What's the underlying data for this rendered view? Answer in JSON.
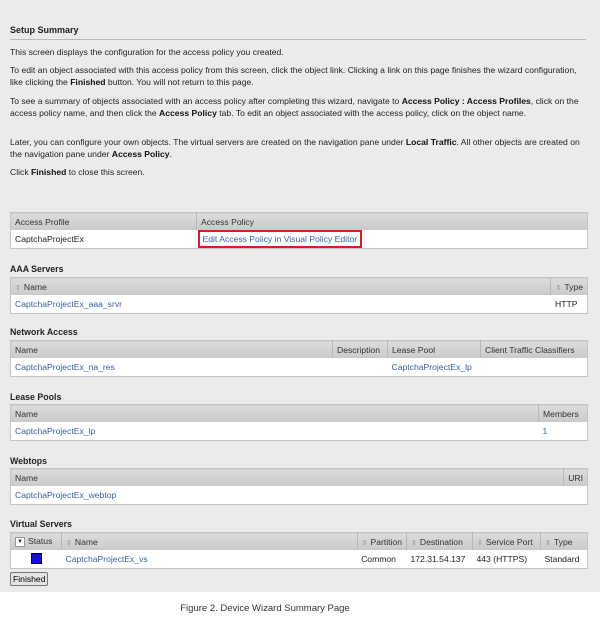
{
  "title": "Setup Summary",
  "paragraphs": {
    "p1": "This screen displays the configuration for the access policy you created.",
    "p2a": "To edit an object associated with this access policy from this screen, click the object link. Clicking a link on this page finishes the wizard configuration, like clicking the ",
    "p2b": "Finished",
    "p2c": " button. You will not return to this page.",
    "p3a": "To see a summary of objects associated with an access policy after completing this wizard, navigate to ",
    "p3b": "Access Policy : Access Profiles",
    "p3c": ", click on the access policy name, and then click the ",
    "p3d": "Access Policy",
    "p3e": " tab. To edit an object associated with the access policy, click on the object name.",
    "p4a": "Later, you can configure your own objects. The virtual servers are created on the navigation pane under ",
    "p4b": "Local Traffic",
    "p4c": ". All other objects are created on the navigation pane under ",
    "p4d": "Access Policy",
    "p4e": ".",
    "p5a": "Click ",
    "p5b": "Finished",
    "p5c": " to close this screen."
  },
  "access": {
    "headers": [
      "Access Profile",
      "Access Policy"
    ],
    "profile": "CaptchaProjectEx",
    "policy_link": "Edit Access Policy in Visual Policy Editor"
  },
  "aaa": {
    "title": "AAA Servers",
    "headers": [
      "Name",
      "Type"
    ],
    "name": "CaptchaProjectEx_aaa_srvr",
    "type": "HTTP"
  },
  "network": {
    "title": "Network Access",
    "headers": [
      "Name",
      "Description",
      "Lease Pool",
      "Client Traffic Classifiers"
    ],
    "name": "CaptchaProjectEx_na_res",
    "description": "",
    "lease_pool": "CaptchaProjectEx_lp",
    "classifiers": ""
  },
  "lease": {
    "title": "Lease Pools",
    "headers": [
      "Name",
      "Members"
    ],
    "name": "CaptchaProjectEx_lp",
    "members": "1"
  },
  "webtops": {
    "title": "Webtops",
    "headers": [
      "Name",
      "URI"
    ],
    "name": "CaptchaProjectEx_webtop",
    "uri": ""
  },
  "virtual": {
    "title": "Virtual Servers",
    "headers": [
      "Status",
      "Name",
      "Partition",
      "Destination",
      "Service Port",
      "Type"
    ],
    "status_color": "#1a0fd0",
    "name": "CaptchaProjectEx_vs",
    "partition": "Common",
    "destination": "172.31.54.137",
    "port": "443 (HTTPS)",
    "type": "Standard"
  },
  "finished_label": "Finished",
  "caption": "Figure 2. Device Wizard Summary Page"
}
